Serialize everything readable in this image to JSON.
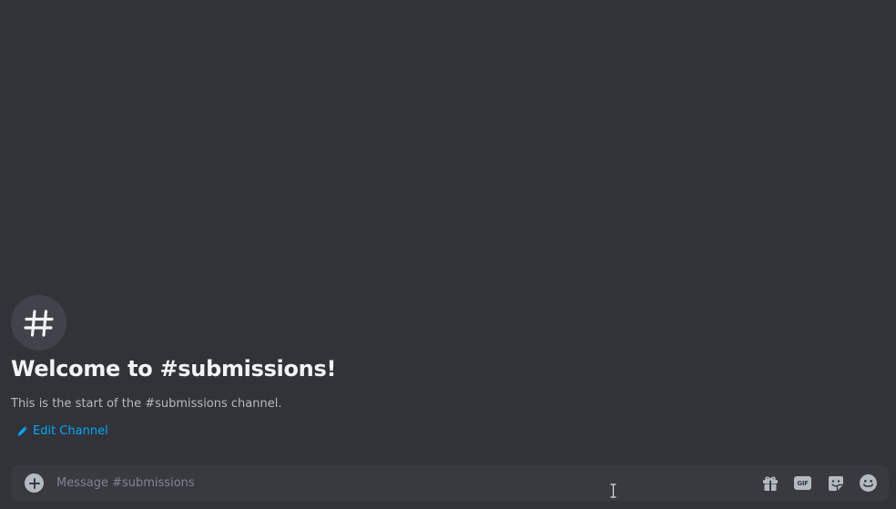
{
  "channel": {
    "welcome_title": "Welcome to #submissions!",
    "welcome_description": "This is the start of the #submissions channel.",
    "edit_label": "Edit Channel",
    "avatar_icon": "hash-icon"
  },
  "composer": {
    "placeholder": "Message #submissions",
    "value": "",
    "add_icon": "plus-circle-icon",
    "gift_icon": "gift-icon",
    "gif_label": "GIF",
    "sticker_icon": "sticker-icon",
    "emoji_icon": "emoji-icon"
  },
  "colors": {
    "background": "#313338",
    "composer_background": "#383a40",
    "title": "#f2f3f5",
    "muted_text": "#b5bac1",
    "link": "#00a8fc"
  }
}
